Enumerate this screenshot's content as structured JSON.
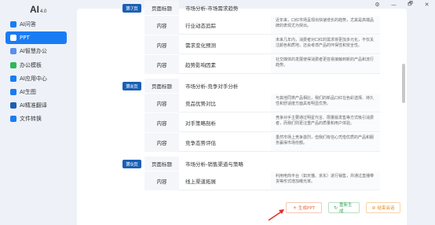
{
  "app": {
    "logo": "AI",
    "version": "4.0"
  },
  "sidebar": {
    "items": [
      {
        "label": "AI问答",
        "icon": "chat-icon",
        "color": "#1a7cf5",
        "active": false
      },
      {
        "label": "PPT",
        "icon": "ppt-icon",
        "color": "#1a7cf5",
        "active": true
      },
      {
        "label": "AI智慧办公",
        "icon": "pen-icon",
        "color": "#5a8ff0",
        "active": false
      },
      {
        "label": "办公模板",
        "icon": "template-icon",
        "color": "#2db85f",
        "active": false
      },
      {
        "label": "AI应用中心",
        "icon": "apps-icon",
        "color": "#1a7cf5",
        "active": false
      },
      {
        "label": "AI生图",
        "icon": "image-icon",
        "color": "#1a7cf5",
        "active": false
      },
      {
        "label": "AI精准翻译",
        "icon": "translate-icon",
        "color": "#1a5fb4",
        "active": false
      },
      {
        "label": "文件转换",
        "icon": "convert-icon",
        "color": "#1a7cf5",
        "active": false
      }
    ]
  },
  "window": {
    "settings": "⚙",
    "minimize": "—",
    "restore": "🗗",
    "close": "✕"
  },
  "sections": [
    {
      "page": "第7页",
      "label": "页面标题",
      "title": "市场分析-市场需求趋势",
      "rows": [
        {
          "label": "内容",
          "item": "行业动态追踪",
          "desc": "近年来，口红市场呈现出快速增长的趋势，尤其是高端品牌的表现尤为突出。"
        },
        {
          "label": "内容",
          "item": "需求变化预测",
          "desc": "未来几年内，消费者对口红的需求将更加多元化，不仅关注颜色和质地，还会考虑产品的环保性和安全性。"
        },
        {
          "label": "内容",
          "item": "趋势影响因素",
          "desc": "社交媒体的发展使得消费者更容易接触到新的产品和流行趋势。"
        }
      ]
    },
    {
      "page": "第8页",
      "label": "页面标题",
      "title": "市场分析-竞争对手分析",
      "rows": [
        {
          "label": "内容",
          "item": "竞品优势对比",
          "desc": "与其他同类产品相比，我们的新品口红在色彩选择、持久性和舒适度方面具有明显优势。"
        },
        {
          "label": "内容",
          "item": "对手策略剖析",
          "desc": "竞争对手主要通过明星代言、限量版发售等方式吸引消费者，而我们则更注重产品的质量和用户体验。"
        },
        {
          "label": "内容",
          "item": "竞争态势评估",
          "desc": "虽然市场上竞争激烈，但我们有信心凭借优质的产品和服务赢得市场份额。"
        }
      ]
    },
    {
      "page": "第9页",
      "label": "页面标题",
      "title": "市场分析-销售渠道与策略",
      "rows": [
        {
          "label": "内容",
          "item": "线上渠道拓展",
          "desc": "利用电商平台（如天猫、京东）进行销售，并通过直播带货等形式增加曝光率。"
        }
      ]
    }
  ],
  "buttons": {
    "generate": "生成PPT",
    "regenerate": "重新生成",
    "end": "结束会话"
  }
}
